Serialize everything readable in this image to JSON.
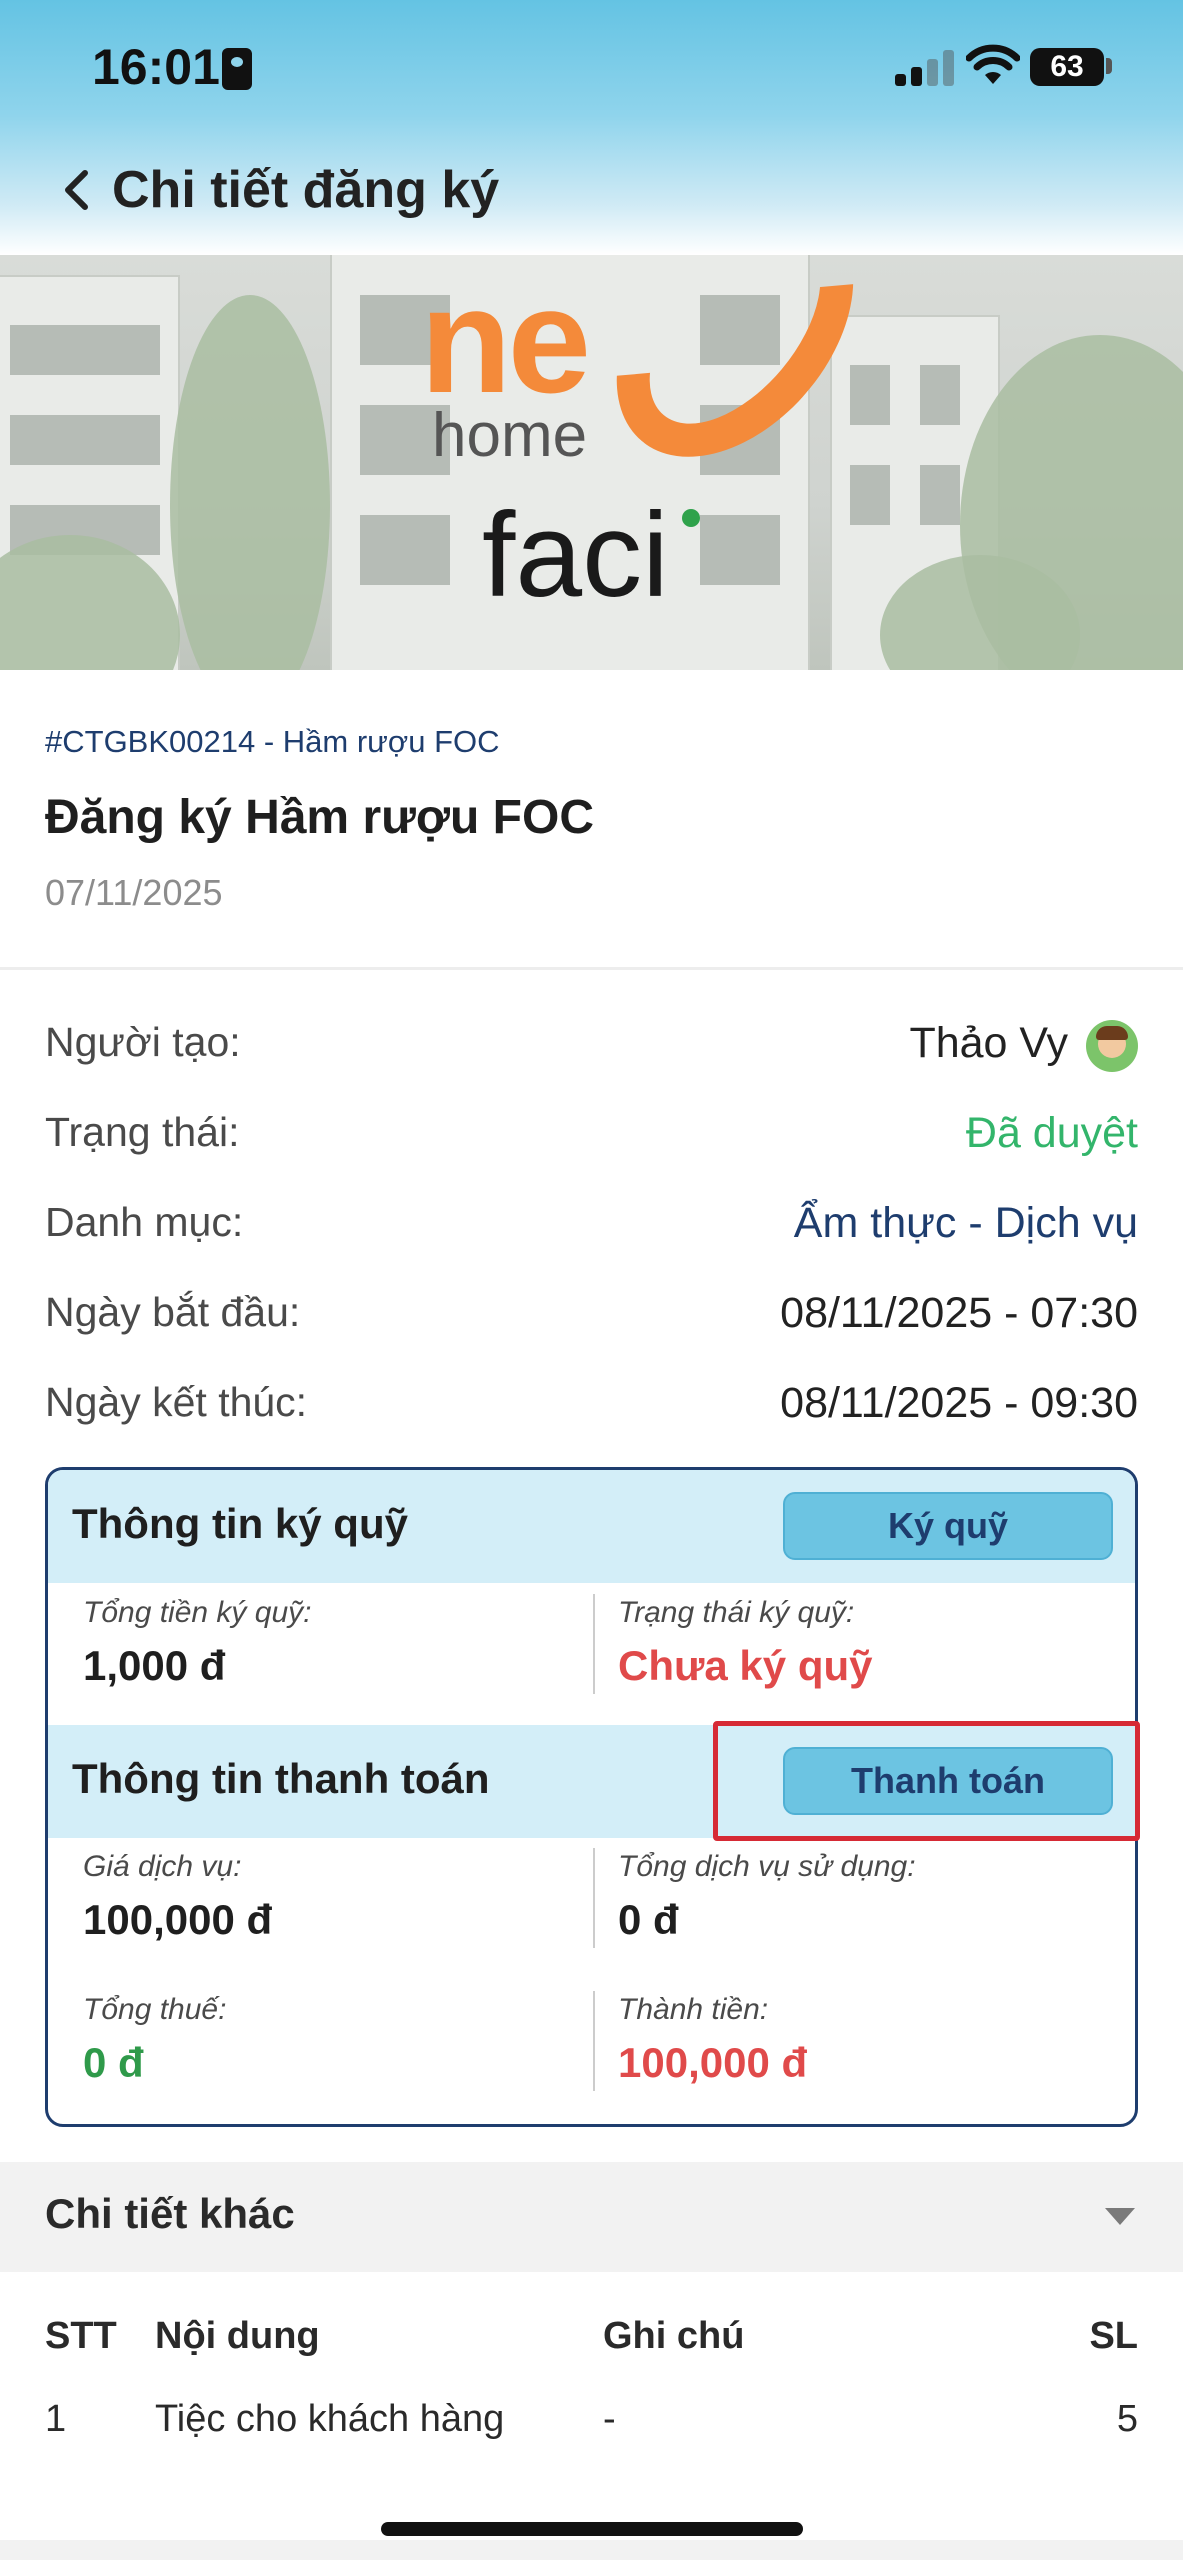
{
  "status_bar": {
    "time": "16:01",
    "battery": "63"
  },
  "header": {
    "title": "Chi tiết đăng ký"
  },
  "banner": {
    "logo_main": "ne",
    "logo_sub": "home",
    "logo_brand": "faci"
  },
  "booking": {
    "code": "#CTGBK00214 - Hầm rượu FOC",
    "title": "Đăng ký Hầm rượu FOC",
    "date": "07/11/2025"
  },
  "info": [
    {
      "label": "Người tạo:",
      "value": "Thảo Vy"
    },
    {
      "label": "Trạng thái:",
      "value": "Đã duyệt"
    },
    {
      "label": "Danh mục:",
      "value": "Ẩm thực - Dịch vụ"
    },
    {
      "label": "Ngày bắt đầu:",
      "value": "08/11/2025 - 07:30"
    },
    {
      "label": "Ngày kết thúc:",
      "value": "08/11/2025 - 09:30"
    }
  ],
  "deposit": {
    "title": "Thông tin ký quỹ",
    "button": "Ký quỹ",
    "total_label": "Tổng tiền ký quỹ:",
    "total_value": "1,000 đ",
    "status_label": "Trạng thái ký quỹ:",
    "status_value": "Chưa ký quỹ"
  },
  "payment": {
    "title": "Thông tin thanh toán",
    "button": "Thanh toán",
    "service_price_label": "Giá dịch vụ:",
    "service_price_value": "100,000 đ",
    "services_used_label": "Tổng dịch vụ sử dụng:",
    "services_used_value": "0 đ",
    "tax_label": "Tổng thuế:",
    "tax_value": "0 đ",
    "total_label": "Thành tiền:",
    "total_value": "100,000 đ"
  },
  "other_details": {
    "title": "Chi tiết khác",
    "columns": [
      "STT",
      "Nội dung",
      "Ghi chú",
      "SL"
    ],
    "rows": [
      [
        "1",
        "Tiệc cho khách hàng",
        "-",
        "5"
      ]
    ]
  },
  "colors": {
    "brand_orange": "#f48a3a",
    "navy": "#1e3d6e",
    "approved_green": "#33b56b",
    "warning_red": "#e04a4a",
    "section_bg": "#d3eef8",
    "button_bg": "#6cc4e2",
    "highlight_red": "#d62a35"
  }
}
